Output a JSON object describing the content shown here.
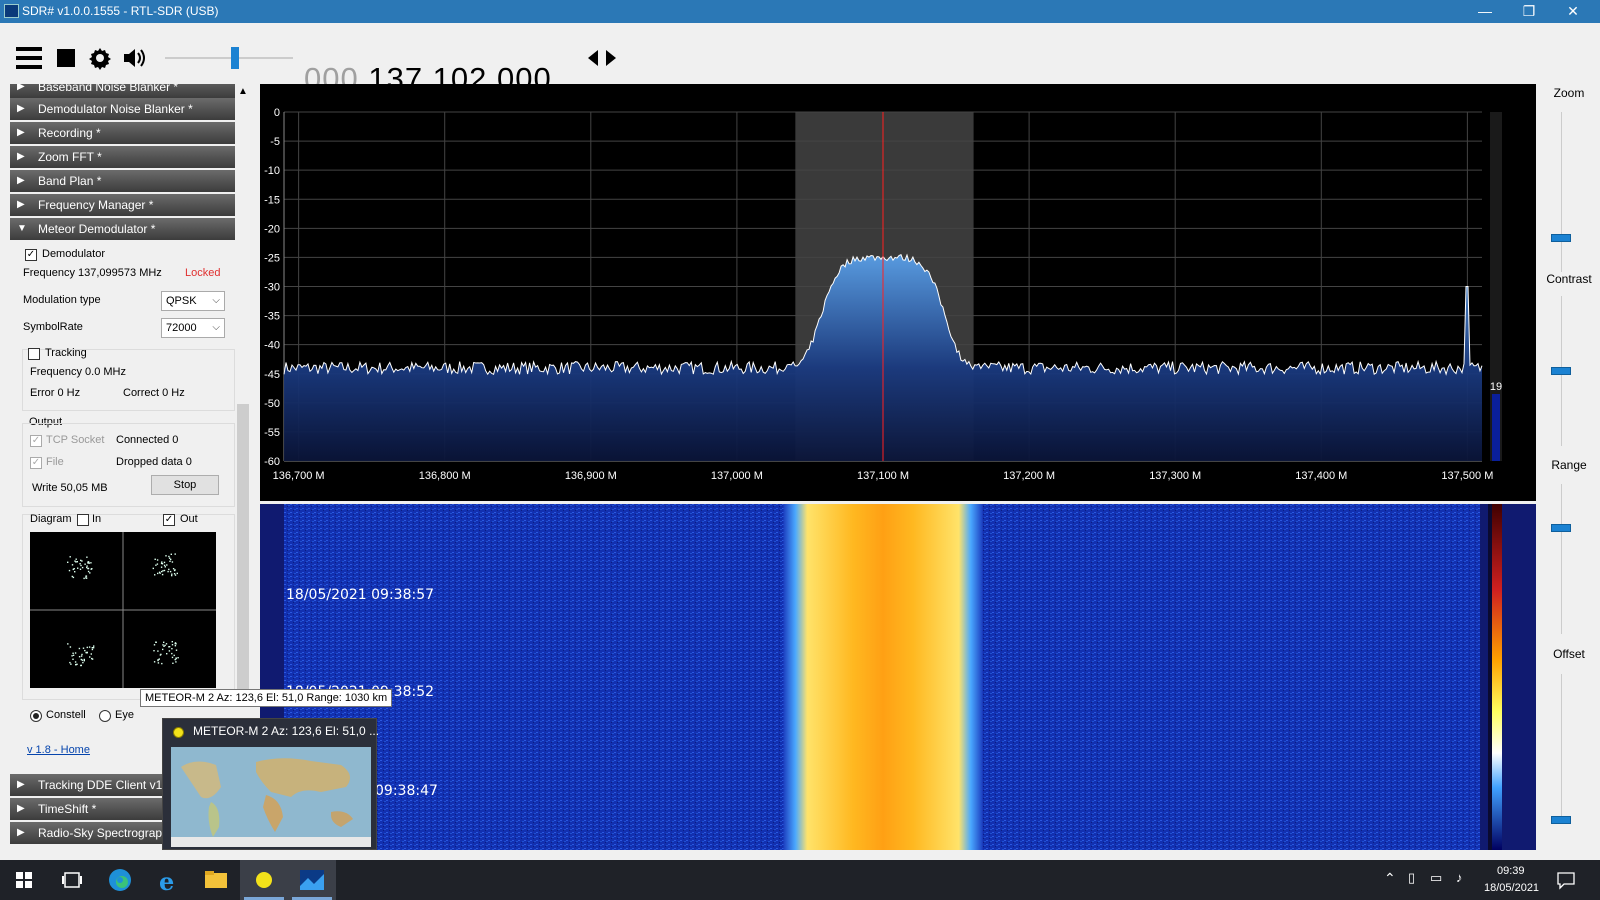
{
  "window": {
    "title": "SDR# v1.0.0.1555 - RTL-SDR (USB)",
    "min": "—",
    "max": "❐",
    "close": "✕"
  },
  "toolbar": {
    "freq_lead": "000.",
    "freq_main": "137.102.000",
    "volume_level": 0.55
  },
  "sidebar": {
    "headers_top": [
      "Baseband Noise Blanker *",
      "Demodulator Noise Blanker *",
      "Recording *",
      "Zoom FFT *",
      "Band Plan *",
      "Frequency Manager *",
      "Meteor Demodulator *"
    ],
    "demod_label": "Demodulator",
    "frequency_text": "Frequency 137,099573 MHz",
    "locked": "Locked",
    "modulation_label": "Modulation type",
    "modulation_value": "QPSK",
    "symbolrate_label": "SymbolRate",
    "symbolrate_value": "72000",
    "tracking_label": "Tracking",
    "tracking_freq": "Frequency 0.0 MHz",
    "error": "Error 0 Hz",
    "correct": "Correct 0 Hz",
    "output_label": "Output",
    "tcp_label": "TCP Socket",
    "tcp_status": "Connected 0",
    "file_label": "File",
    "file_status": "Dropped data 0",
    "write": "Write 50,05 MB",
    "stop_label": "Stop",
    "diagram_label": "Diagram",
    "in_label": "In",
    "out_label": "Out",
    "constell_label": "Constell",
    "eye_label": "Eye",
    "home_link": "v 1.8 - Home",
    "headers_bottom": [
      "Tracking DDE Client v1.",
      "TimeShift *",
      "Radio-Sky Spectrograp"
    ]
  },
  "tooltip": "METEOR-M 2  Az: 123,6 El: 51,0 Range: 1030 km",
  "popup": {
    "title": "METEOR-M 2  Az: 123,6 El: 51,0 ..."
  },
  "chart_data": {
    "type": "area",
    "title": "",
    "xlabel": "",
    "ylabel": "",
    "x_ticks": [
      "136,700 M",
      "136,800 M",
      "136,900 M",
      "137,000 M",
      "137,100 M",
      "137,200 M",
      "137,300 M",
      "137,400 M",
      "137,500 M"
    ],
    "y_ticks": [
      "0",
      "-5",
      "-10",
      "-15",
      "-20",
      "-25",
      "-30",
      "-35",
      "-40",
      "-45",
      "-50",
      "-55",
      "-60"
    ],
    "xlim_mhz": [
      136.69,
      137.51
    ],
    "ylim_db": [
      -60,
      0
    ],
    "noise_floor_db": -44,
    "signal_center_mhz": 137.1,
    "signal_peak_db": -25,
    "signal_width_mhz": 0.11,
    "tuned_freq_mhz": 137.1,
    "filter_band_mhz": [
      137.04,
      137.162
    ],
    "spur_mhz": 137.5,
    "side_value": "19"
  },
  "waterfall": {
    "timestamps": [
      "18/05/2021 09:38:57",
      "18/05/2021 09:38:52",
      "09:38:47"
    ]
  },
  "rightpanel": {
    "labels": [
      "Zoom",
      "Contrast",
      "Range",
      "Offset"
    ],
    "values": [
      0.2,
      0.5,
      0.72,
      0.0
    ]
  },
  "taskbar": {
    "time": "09:39",
    "date": "18/05/2021"
  }
}
